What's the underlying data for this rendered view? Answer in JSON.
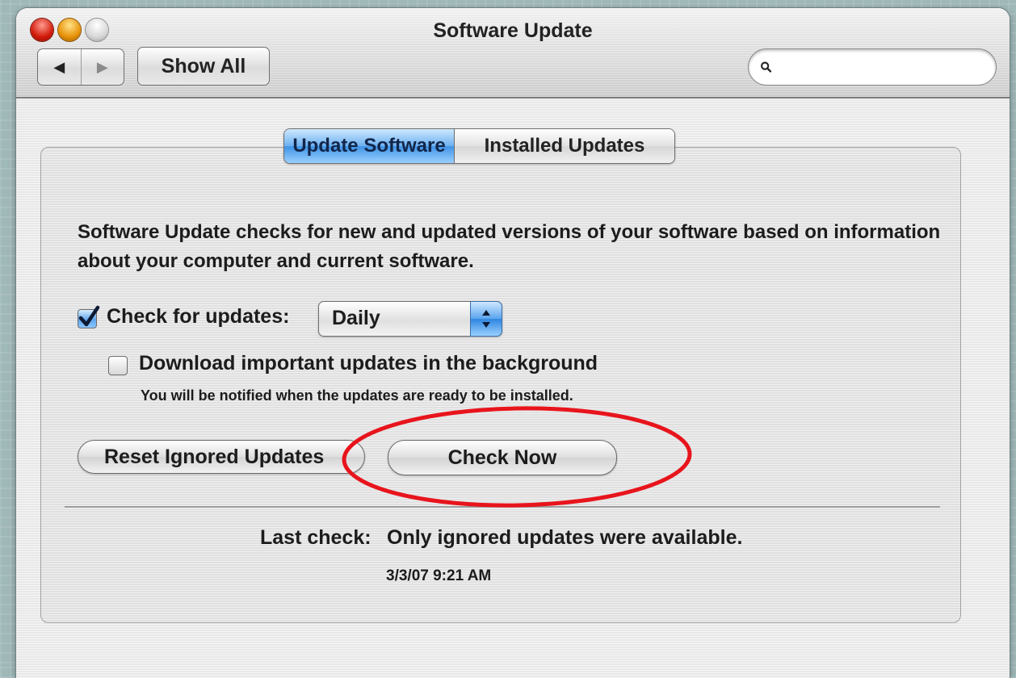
{
  "window": {
    "title": "Software Update"
  },
  "toolbar": {
    "back_glyph": "◀",
    "forward_glyph": "▶",
    "show_all_label": "Show All",
    "search_value": "",
    "search_placeholder": ""
  },
  "tabs": [
    {
      "label": "Update Software",
      "selected": true
    },
    {
      "label": "Installed Updates",
      "selected": false
    }
  ],
  "description": "Software Update checks for new and updated versions of your software based on information about your computer and current software.",
  "check_for_updates": {
    "label": "Check for updates:",
    "checked": true,
    "frequency": "Daily"
  },
  "download_background": {
    "label": "Download important updates in the background",
    "checked": false,
    "note": "You will be notified when the updates are ready to be installed."
  },
  "buttons": {
    "reset_ignored": "Reset Ignored Updates",
    "check_now": "Check Now"
  },
  "last_check": {
    "label": "Last check:",
    "value": "Only ignored updates were available.",
    "timestamp": "3/3/07 9:21 AM"
  },
  "colors": {
    "highlight_circle": "#e8141c",
    "selected_tab": "#4a9be9",
    "checkbox_checked": "#5fa6ee"
  },
  "icons": [
    "close-button-icon",
    "minimize-button-icon",
    "zoom-button-icon",
    "back-arrow-icon",
    "forward-arrow-icon",
    "search-icon",
    "checkmark-icon",
    "popup-arrows-icon"
  ]
}
